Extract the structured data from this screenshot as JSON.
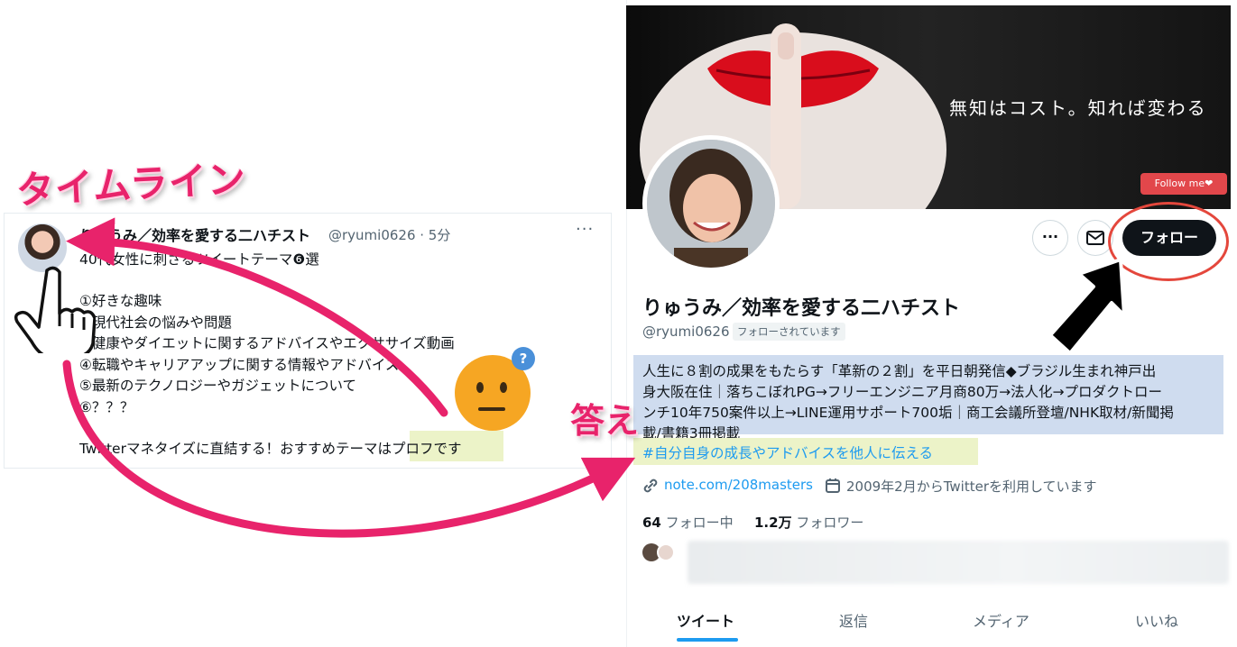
{
  "annotations": {
    "timeline_label": "タイムライン",
    "answer_label": "答え"
  },
  "tweet": {
    "author_name": "りゅうみ／効率を愛する二ハチスト",
    "handle_time": "@ryumi0626 · 5分",
    "more": "···",
    "lines": [
      "40代女性に刺さるツイートテーマ❻選",
      "",
      "①好きな趣味",
      "②現代社会の悩みや問題",
      "③健康やダイエットに関するアドバイスやエクササイズ動画",
      "④転職やキャリアアップに関する情報やアドバイス",
      "⑤最新のテクノロジーやガジェットについて",
      "⑥？？？",
      "",
      "Twitterマネタイズに直結する！おすすめテーマはプロフです"
    ]
  },
  "profile": {
    "banner_text": "無知はコスト。知れば変わる",
    "follow_me_badge": "Follow me❤",
    "more_button": "···",
    "follow_button": "フォロー",
    "name": "りゅうみ／効率を愛する二ハチスト",
    "handle": "@ryumi0626",
    "follows_you": "フォローされています",
    "bio_lines": [
      "人生に８割の成果をもたらす「革新の２割」を平日朝発信◆ブラジル生まれ神戸出",
      "身大阪在住｜落ちこぼれPG→フリーエンジニア月商80万→法人化→プロダクトロー",
      "ンチ10年750案件以上→LINE運用サポート700垢｜商工会議所登壇/NHK取材/新聞掲",
      "載/書籍3冊掲載"
    ],
    "bio_tag": "#自分自身の成長やアドバイスを他人に伝える",
    "link": "note.com/208masters",
    "joined": "2009年2月からTwitterを利用しています",
    "following_count": "64",
    "following_label": "フォロー中",
    "followers_count": "1.2万",
    "followers_label": "フォロワー"
  },
  "tabs": [
    "ツイート",
    "返信",
    "メディア",
    "いいね"
  ],
  "colors": {
    "annotation_pink": "#e8236b",
    "follow_ring": "#e4473c",
    "link_blue": "#1d9bf0",
    "bio_highlight": "#cfdcef",
    "tag_highlight": "#ecf3c8"
  }
}
